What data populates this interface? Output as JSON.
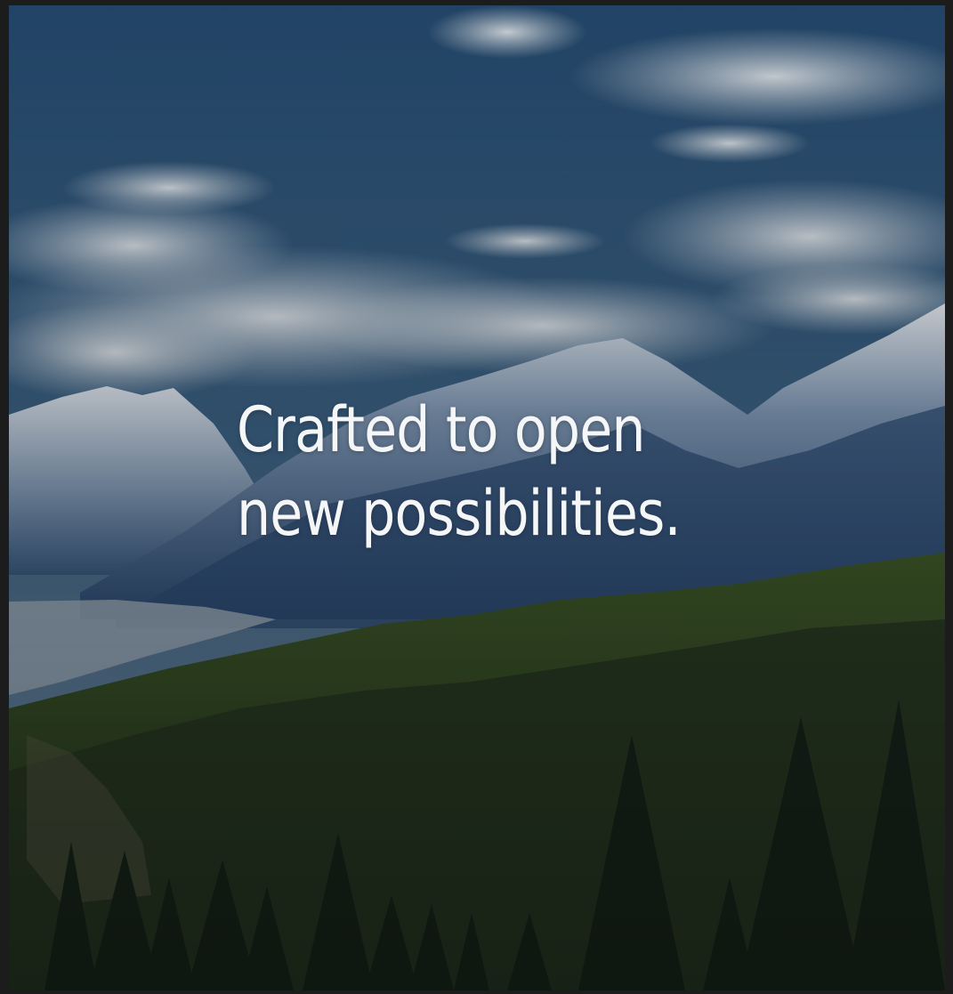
{
  "hero": {
    "line1": "Crafted to open",
    "line2": "new possibilities."
  },
  "scene": {
    "subject": "mountain-valley-landscape",
    "colors": {
      "sky_top": "#2a5278",
      "sky_bottom": "#6f8aa3",
      "cloud": "#c9d1d8",
      "snow": "#dfe6ee",
      "mountain_shadow": "#2c4a70",
      "forest_dark": "#1d2a1c",
      "forest_mid": "#35452a",
      "river": "#aab7c4",
      "frame": "#1c1c1c"
    }
  }
}
